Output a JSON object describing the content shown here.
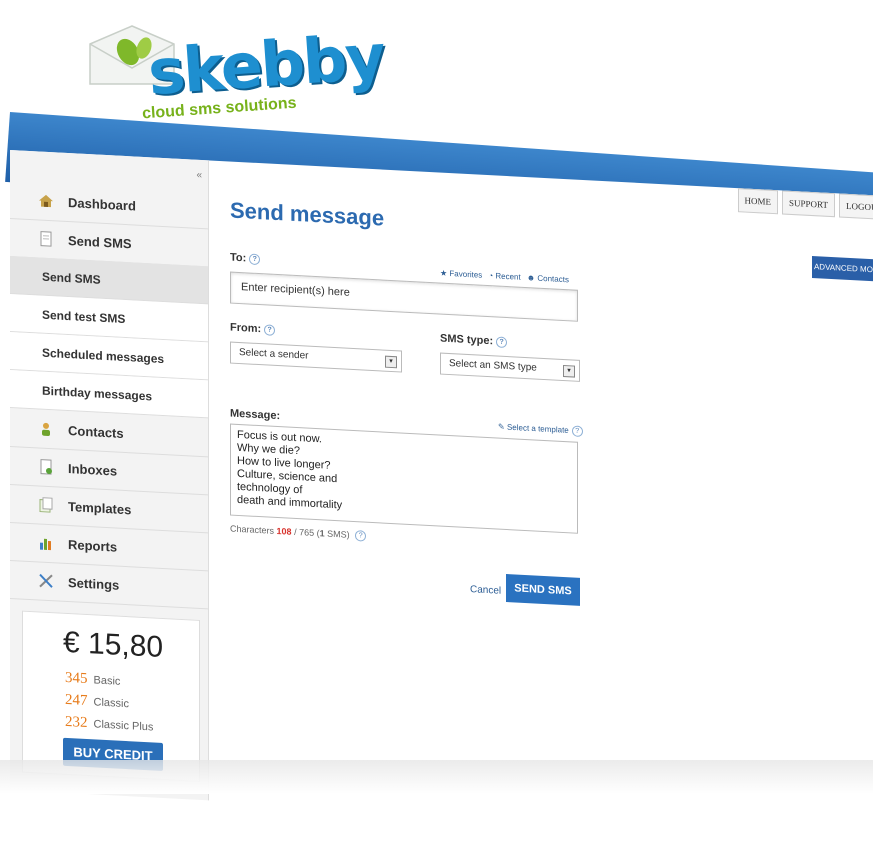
{
  "brand": {
    "name": "skebby",
    "tagline": "cloud sms solutions",
    "primary_color": "#2c6ab0",
    "accent_color": "#77b21b"
  },
  "topnav": [
    "HOME",
    "SUPPORT",
    "LOGOUT"
  ],
  "sidebar": {
    "collapse_label": "«",
    "items": [
      {
        "label": "Dashboard",
        "icon": "home-icon"
      },
      {
        "label": "Send SMS",
        "icon": "document-icon"
      }
    ],
    "subitems": [
      {
        "label": "Send SMS",
        "active": true
      },
      {
        "label": "Send test SMS"
      },
      {
        "label": "Scheduled messages"
      },
      {
        "label": "Birthday messages"
      }
    ],
    "items2": [
      {
        "label": "Contacts",
        "icon": "contacts-icon"
      },
      {
        "label": "Inboxes",
        "icon": "inbox-icon"
      },
      {
        "label": "Templates",
        "icon": "templates-icon"
      },
      {
        "label": "Reports",
        "icon": "chart-icon"
      },
      {
        "label": "Settings",
        "icon": "tools-icon"
      }
    ]
  },
  "credit": {
    "amount": "€ 15,80",
    "rows": [
      {
        "count": "345",
        "label": "Basic"
      },
      {
        "count": "247",
        "label": "Classic"
      },
      {
        "count": "232",
        "label": "Classic Plus"
      }
    ],
    "buy_label": "BUY CREDIT"
  },
  "main": {
    "title": "Send message",
    "advanced_label": "ADVANCED MODE",
    "to_label": "To:",
    "quick_links": [
      "Favorites",
      "Recent",
      "Contacts"
    ],
    "to_placeholder": "Enter recipient(s) here",
    "from_label": "From:",
    "from_value": "Select a sender",
    "sms_type_label": "SMS type:",
    "sms_type_value": "Select an SMS type",
    "message_label": "Message:",
    "template_link": "Select a template",
    "message_lines": [
      "Focus is out now.",
      "Why we die?",
      "How to live longer?",
      "Culture, science and",
      "technology of",
      "death and immortality"
    ],
    "chars_prefix": "Characters",
    "chars_count": "108",
    "chars_total": "/ 765 (",
    "chars_sms": "1",
    "chars_suffix": " SMS)",
    "cancel_label": "Cancel",
    "send_label": "SEND SMS",
    "help_glyph": "?"
  }
}
